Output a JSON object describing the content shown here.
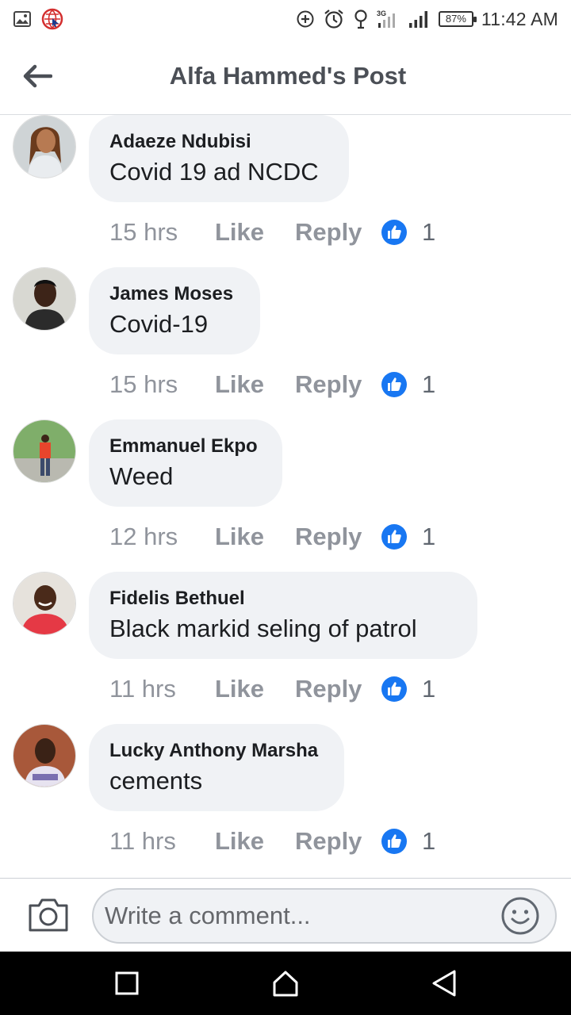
{
  "status_bar": {
    "battery": "87%",
    "time": "11:42 AM"
  },
  "header": {
    "title": "Alfa Hammed's Post",
    "back_icon": "arrow-left-icon"
  },
  "comments": [
    {
      "author": "Adaeze Ndubisi",
      "text": "Covid 19 ad NCDC",
      "time": "15 hrs",
      "like_label": "Like",
      "reply_label": "Reply",
      "reactions": "1"
    },
    {
      "author": "James Moses",
      "text": "Covid-19",
      "time": "15 hrs",
      "like_label": "Like",
      "reply_label": "Reply",
      "reactions": "1"
    },
    {
      "author": "Emmanuel Ekpo",
      "text": "Weed",
      "time": "12 hrs",
      "like_label": "Like",
      "reply_label": "Reply",
      "reactions": "1"
    },
    {
      "author": "Fidelis Bethuel",
      "text": "Black markid seling of patrol",
      "time": "11 hrs",
      "like_label": "Like",
      "reply_label": "Reply",
      "reactions": "1"
    },
    {
      "author": "Lucky Anthony Marsha",
      "text": "cements",
      "time": "11 hrs",
      "like_label": "Like",
      "reply_label": "Reply",
      "reactions": "1"
    }
  ],
  "composer": {
    "placeholder": "Write a comment..."
  },
  "colors": {
    "like_blue": "#1877f2",
    "bubble": "#f0f2f5",
    "muted": "#90949c"
  }
}
